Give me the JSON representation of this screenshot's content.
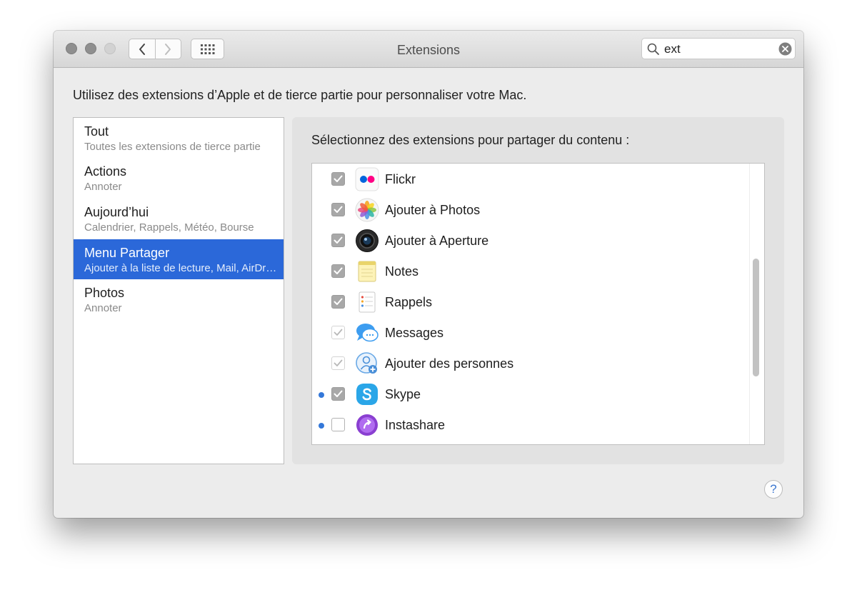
{
  "window": {
    "title": "Extensions",
    "search": {
      "value": "ext"
    },
    "intro": "Utilisez des extensions d’Apple et de tierce partie pour personnaliser votre Mac.",
    "help_label": "?"
  },
  "sidebar": {
    "items": [
      {
        "title": "Tout",
        "subtitle": "Toutes les extensions de tierce partie",
        "selected": false
      },
      {
        "title": "Actions",
        "subtitle": "Annoter",
        "selected": false
      },
      {
        "title": "Aujourd’hui",
        "subtitle": "Calendrier, Rappels, Météo, Bourse",
        "selected": false
      },
      {
        "title": "Menu Partager",
        "subtitle": "Ajouter à la liste de lecture, Mail, AirDrop",
        "selected": true
      },
      {
        "title": "Photos",
        "subtitle": "Annoter",
        "selected": false
      }
    ]
  },
  "panel": {
    "label": "Sélectionnez des extensions pour partager du contenu :",
    "extensions": [
      {
        "name": "Flickr",
        "checked": true,
        "enabled": true,
        "third_party": false,
        "icon": "flickr-icon"
      },
      {
        "name": "Ajouter à Photos",
        "checked": true,
        "enabled": true,
        "third_party": false,
        "icon": "photos-icon"
      },
      {
        "name": "Ajouter à Aperture",
        "checked": true,
        "enabled": true,
        "third_party": false,
        "icon": "aperture-icon"
      },
      {
        "name": "Notes",
        "checked": true,
        "enabled": true,
        "third_party": false,
        "icon": "notes-icon"
      },
      {
        "name": "Rappels",
        "checked": true,
        "enabled": true,
        "third_party": false,
        "icon": "reminders-icon"
      },
      {
        "name": "Messages",
        "checked": true,
        "enabled": false,
        "third_party": false,
        "icon": "messages-icon"
      },
      {
        "name": "Ajouter des personnes",
        "checked": true,
        "enabled": false,
        "third_party": false,
        "icon": "add-people-icon"
      },
      {
        "name": "Skype",
        "checked": true,
        "enabled": true,
        "third_party": true,
        "icon": "skype-icon"
      },
      {
        "name": "Instashare",
        "checked": false,
        "enabled": true,
        "third_party": true,
        "icon": "instashare-icon"
      }
    ]
  },
  "colors": {
    "selection": "#2b68d9",
    "third_party_dot": "#3478d9",
    "checkbox_checked": "#a8a8a8"
  }
}
